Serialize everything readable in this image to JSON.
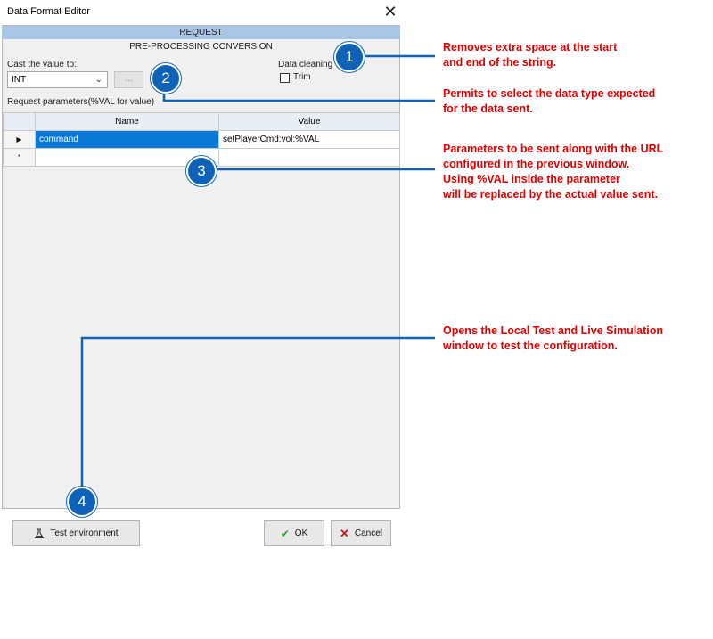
{
  "window": {
    "title": "Data Format Editor"
  },
  "request": {
    "header": "REQUEST",
    "subheader": "PRE-PROCESSING CONVERSION",
    "cast_label": "Cast the value to:",
    "cast_value": "INT",
    "dots_label": "...",
    "cleaning_label": "Data cleaning",
    "trim_label": "Trim",
    "params_label": "Request parameters(%VAL for value)"
  },
  "grid": {
    "columns": [
      "Name",
      "Value"
    ],
    "rows": [
      {
        "marker": "▶",
        "name": "command",
        "value": "setPlayerCmd:vol:%VAL"
      },
      {
        "marker": "*",
        "name": "",
        "value": ""
      }
    ]
  },
  "buttons": {
    "test_env": "Test environment",
    "ok": "OK",
    "cancel": "Cancel"
  },
  "callouts": {
    "c1": "1",
    "c2": "2",
    "c3": "3",
    "c4": "4",
    "a1_line1": "Removes extra space at the start",
    "a1_line2": "and end of the string.",
    "a2_line1": "Permits to select the data type expected",
    "a2_line2": "for the data sent.",
    "a3_line1": "Parameters to be sent along with the URL",
    "a3_line2": "configured in the previous window.",
    "a3_line3": "Using %VAL inside the parameter",
    "a3_line4": "will be replaced by the actual value sent.",
    "a4_line1": "Opens the Local Test and Live Simulation",
    "a4_line2": "window to test the configuration."
  },
  "colors": {
    "accent": "#0e63b8",
    "annotation": "#e00000",
    "selection": "#0a78d7",
    "header": "#aac6e6"
  }
}
